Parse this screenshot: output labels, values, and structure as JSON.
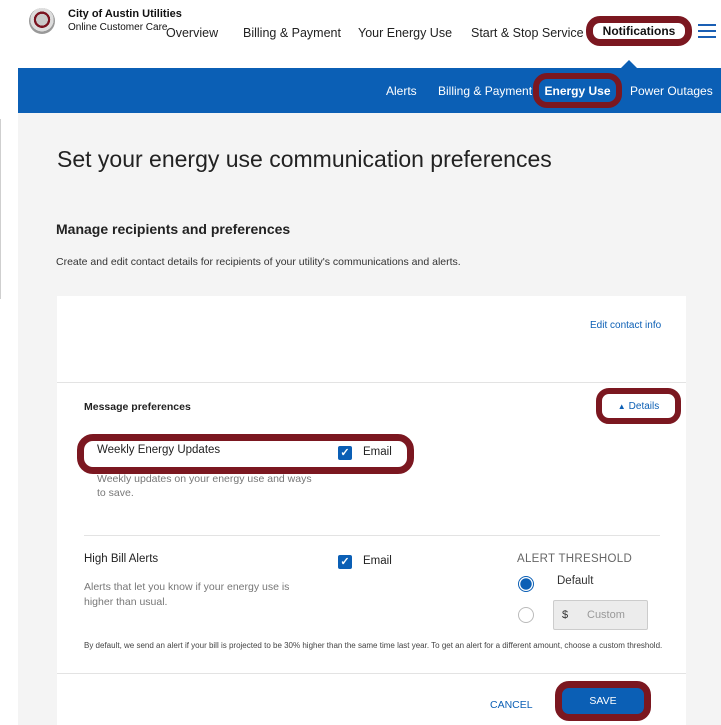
{
  "header": {
    "brand_line1": "City of Austin Utilities",
    "brand_line2": "Online Customer Care",
    "nav": {
      "overview": "Overview",
      "billing": "Billing & Payment",
      "energy": "Your Energy Use",
      "service": "Start & Stop Service",
      "notifications": "Notifications"
    }
  },
  "subnav": {
    "alerts": "Alerts",
    "billing": "Billing & Payment",
    "energy_use": "Energy Use",
    "power_outages": "Power Outages"
  },
  "page": {
    "title": "Set your energy use communication preferences",
    "section_title": "Manage recipients and preferences",
    "section_desc": "Create and edit contact details for recipients of your utility's communications and alerts."
  },
  "card": {
    "edit_contact": "Edit contact info",
    "message_preferences": "Message preferences",
    "details": "Details",
    "weekly": {
      "title": "Weekly Energy Updates",
      "channel": "Email",
      "checked": true,
      "desc": "Weekly updates on your energy use and ways to save."
    },
    "high_bill": {
      "title": "High Bill Alerts",
      "channel": "Email",
      "checked": true,
      "desc": "Alerts that let you know if your energy use is higher than usual."
    },
    "threshold": {
      "title": "ALERT THRESHOLD",
      "default_label": "Default",
      "currency": "$",
      "custom_placeholder": "Custom",
      "selected": "Default"
    },
    "footnote": "By default, we send an alert if your bill is projected to be 30% higher than the same time last year. To get an alert for a different amount, choose a custom threshold.",
    "cancel": "CANCEL",
    "save": "SAVE"
  },
  "colors": {
    "accent_blue": "#0b5fb5",
    "highlight_maroon": "#7b1720",
    "content_bg": "#f4f4f4"
  },
  "icons": [
    "city-seal-icon",
    "hamburger-menu-icon",
    "checkbox-checked-icon",
    "caret-up-icon"
  ]
}
